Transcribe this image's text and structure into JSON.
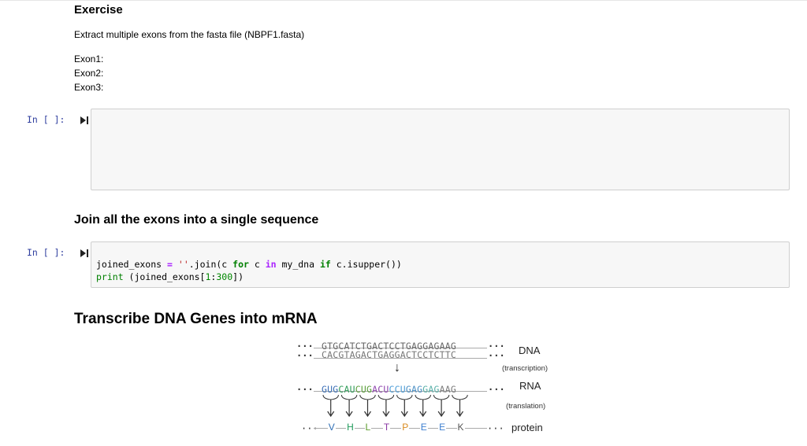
{
  "exercise": {
    "title": "Exercise",
    "instruction": "Extract multiple exons from the fasta file (NBPF1.fasta)",
    "exon_lines": [
      "Exon1:",
      "Exon2:",
      "Exon3:"
    ]
  },
  "cell1": {
    "prompt": "In [ ]:"
  },
  "join_section": {
    "heading": "Join all the exons into a single sequence"
  },
  "cell2": {
    "prompt": "In [ ]:",
    "line1": {
      "a": "joined_exons ",
      "eq": "=",
      "s": " ",
      "str": "''",
      "b": ".join(c ",
      "for": "for",
      "c": " c ",
      "in": "in",
      "d": " my_dna ",
      "if": "if",
      "e": " c.isupper())"
    },
    "line2": {
      "print": "print",
      "a": " (joined_exons[",
      "n1": "1",
      "colon": ":",
      "n2": "300",
      "b": "])"
    }
  },
  "transcribe_section": {
    "heading": "Transcribe DNA Genes into mRNA"
  },
  "diagram": {
    "dots": "···",
    "dna_top": "GTGCATCTGACTCCTGAGGAGAAG",
    "dna_bottom": "CACGTAGACTGAGGACTCCTCTTC",
    "rna_codons": [
      "GUG",
      "CAU",
      "CUG",
      "ACU",
      "CCU",
      "GAG",
      "GAG",
      "AAG"
    ],
    "rna_colors": [
      "#3b6fb6",
      "#2e9b57",
      "#5a9e3a",
      "#8e44ad",
      "#4c9dd8",
      "#4a8fc4",
      "#58b0a8",
      "#7a7a7a"
    ],
    "amino_acids": [
      "V",
      "H",
      "L",
      "T",
      "P",
      "E",
      "E",
      "K"
    ],
    "aa_colors": [
      "#2f6fb5",
      "#1f9a5a",
      "#5b9b2c",
      "#8b3aa5",
      "#d98a1e",
      "#3d7fd0",
      "#3d7fd0",
      "#555555"
    ],
    "down_arrow": "↓",
    "label_dna": "DNA",
    "label_transcription": "(transcription)",
    "label_rna": "RNA",
    "label_translation": "(translation)",
    "label_protein": "protein"
  }
}
